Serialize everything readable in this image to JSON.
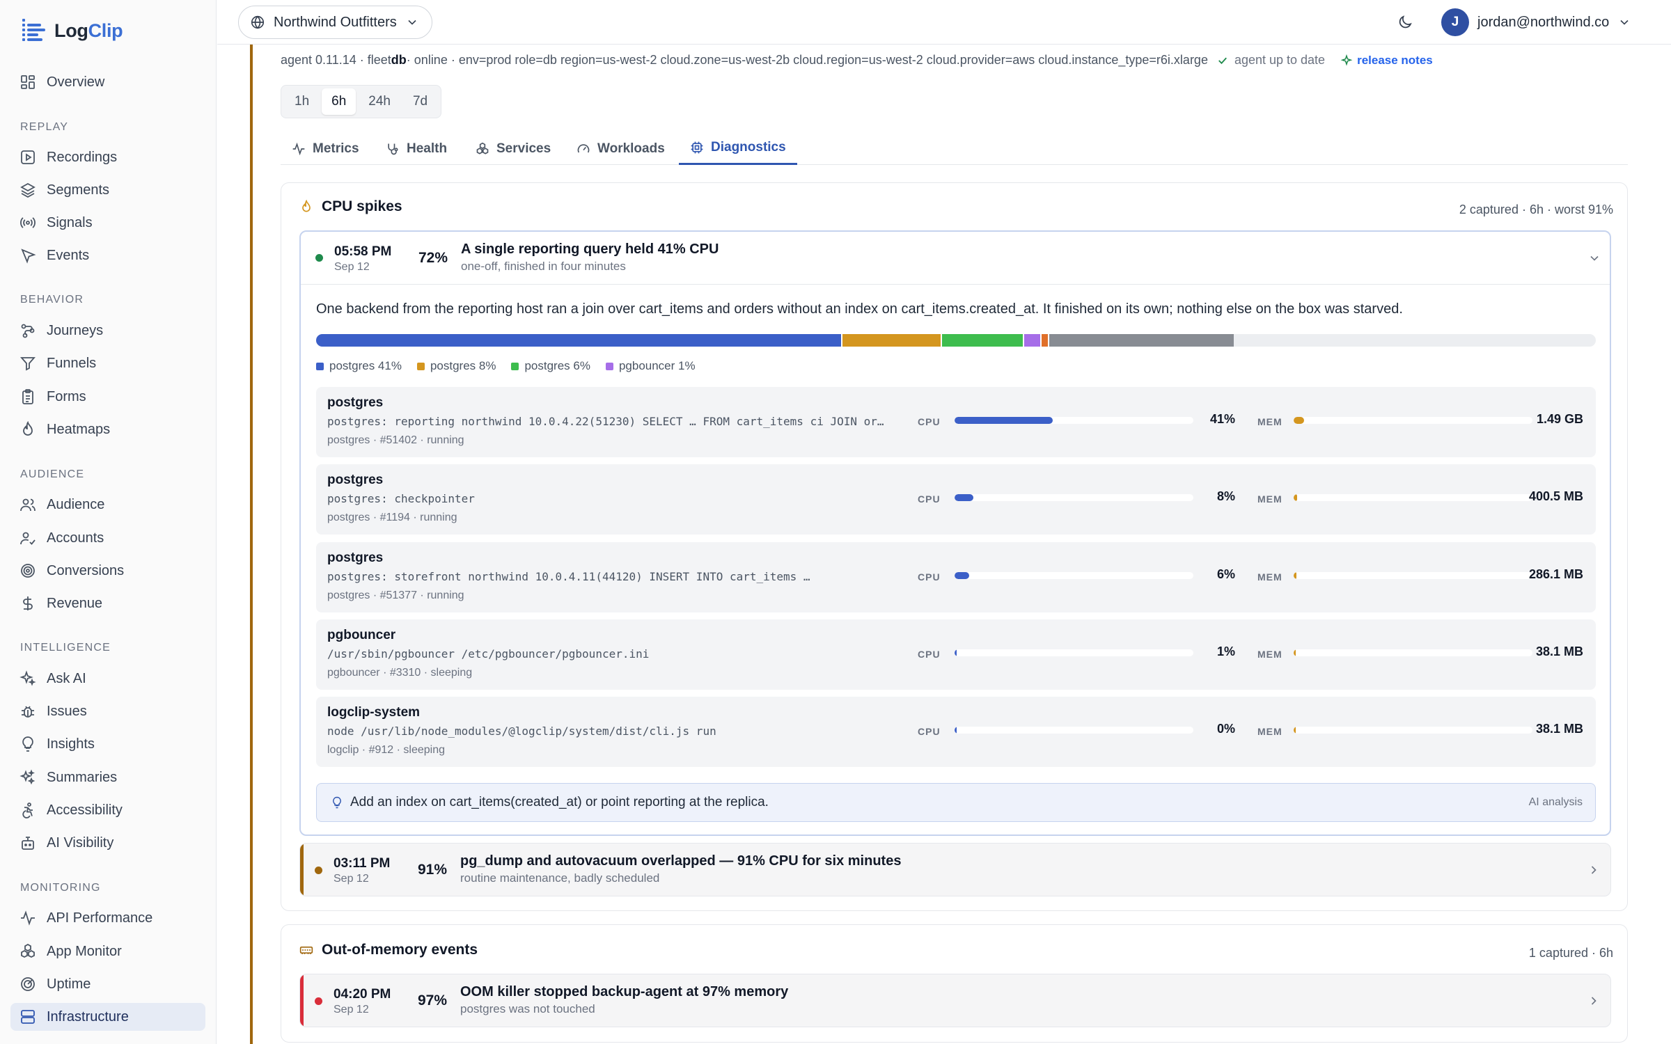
{
  "app": {
    "logo_main": "Log",
    "logo_accent": "Clip"
  },
  "sidebar": {
    "overview": "Overview",
    "sections": {
      "replay": "REPLAY",
      "behavior": "BEHAVIOR",
      "audience": "AUDIENCE",
      "intelligence": "INTELLIGENCE",
      "monitoring": "MONITORING"
    },
    "replay": [
      "Recordings",
      "Segments",
      "Signals",
      "Events"
    ],
    "behavior": [
      "Journeys",
      "Funnels",
      "Forms",
      "Heatmaps"
    ],
    "audience": [
      "Audience",
      "Accounts",
      "Conversions",
      "Revenue"
    ],
    "intelligence": [
      "Ask AI",
      "Issues",
      "Insights",
      "Summaries",
      "Accessibility",
      "AI Visibility"
    ],
    "monitoring": [
      "API Performance",
      "App Monitor",
      "Uptime",
      "Infrastructure"
    ],
    "active": "Infrastructure"
  },
  "topbar": {
    "org": "Northwind Outfitters",
    "user_initial": "J",
    "user_email": "jordan@northwind.co"
  },
  "host": {
    "meta_prefix": "agent 0.11.14 · fleet ",
    "fleet": "db",
    "meta_suffix": " · online · env=prod role=db region=us-west-2 cloud.zone=us-west-2b cloud.region=us-west-2 cloud.provider=aws cloud.instance_type=r6i.xlarge",
    "agent_status": "agent up to date",
    "release_notes": "release notes"
  },
  "ranges": {
    "options": [
      "1h",
      "6h",
      "24h",
      "7d"
    ],
    "selected": "6h"
  },
  "tabs": {
    "items": [
      "Metrics",
      "Health",
      "Services",
      "Workloads",
      "Diagnostics"
    ],
    "active": "Diagnostics"
  },
  "cpu_spikes": {
    "title": "CPU spikes",
    "summary": "2 captured · 6h · worst 91%",
    "expanded": {
      "time": "05:58 PM",
      "date": "Sep 12",
      "pct": "72%",
      "title": "A single reporting query held 41% CPU",
      "subtitle": "one-off, finished in four minutes",
      "description": "One backend from the reporting host ran a join over cart_items and orders without an index on cart_items.created_at. It finished on its own; nothing else on the box was starved.",
      "breakdown": [
        {
          "label": "postgres",
          "share": 41,
          "color": "#3b5fc8"
        },
        {
          "label": "postgres",
          "share": 7.8,
          "color": "#d4961f"
        },
        {
          "label": "postgres",
          "share": 6.4,
          "color": "#3ebd4e"
        },
        {
          "label": "pgbouncer",
          "share": 1.4,
          "color": "#a66ee8"
        },
        {
          "label": "",
          "share": 0.6,
          "color": "#e0702a"
        },
        {
          "label": "",
          "share": 14.5,
          "color": "#888c93"
        }
      ],
      "legend": [
        {
          "label": "postgres 41%",
          "color": "#3b5fc8"
        },
        {
          "label": "postgres 8%",
          "color": "#d4961f"
        },
        {
          "label": "postgres 6%",
          "color": "#3ebd4e"
        },
        {
          "label": "pgbouncer 1%",
          "color": "#a66ee8"
        }
      ],
      "processes": [
        {
          "name": "postgres",
          "cmd": "postgres: reporting northwind 10.0.4.22(51230) SELECT … FROM cart_items ci JOIN or…",
          "meta": "postgres · #51402 · running",
          "cpu_label": "CPU",
          "cpu": 41,
          "cpu_text": "41%",
          "mem_label": "MEM",
          "mem": 4.5,
          "mem_text": "1.49 GB"
        },
        {
          "name": "postgres",
          "cmd": "postgres: checkpointer",
          "meta": "postgres · #1194 · running",
          "cpu_label": "CPU",
          "cpu": 8,
          "cpu_text": "8%",
          "mem_label": "MEM",
          "mem": 1.5,
          "mem_text": "400.5 MB"
        },
        {
          "name": "postgres",
          "cmd": "postgres: storefront northwind 10.0.4.11(44120) INSERT INTO cart_items …",
          "meta": "postgres · #51377 · running",
          "cpu_label": "CPU",
          "cpu": 6,
          "cpu_text": "6%",
          "mem_label": "MEM",
          "mem": 1.3,
          "mem_text": "286.1 MB"
        },
        {
          "name": "pgbouncer",
          "cmd": "/usr/sbin/pgbouncer /etc/pgbouncer/pgbouncer.ini",
          "meta": "pgbouncer · #3310 · sleeping",
          "cpu_label": "CPU",
          "cpu": 1,
          "cpu_text": "1%",
          "mem_label": "MEM",
          "mem": 1,
          "mem_text": "38.1 MB"
        },
        {
          "name": "logclip-system",
          "cmd": "node /usr/lib/node_modules/@logclip/system/dist/cli.js run",
          "meta": "logclip · #912 · sleeping",
          "cpu_label": "CPU",
          "cpu": 0.8,
          "cpu_text": "0%",
          "mem_label": "MEM",
          "mem": 1,
          "mem_text": "38.1 MB"
        }
      ],
      "ai_text": "Add an index on cart_items(created_at) or point reporting at the replica.",
      "ai_tag": "AI analysis"
    },
    "collapsed": {
      "time": "03:11 PM",
      "date": "Sep 12",
      "pct": "91%",
      "title": "pg_dump and autovacuum overlapped — 91% CPU for six minutes",
      "subtitle": "routine maintenance, badly scheduled",
      "accent": "#a0670e"
    }
  },
  "oom": {
    "title": "Out-of-memory events",
    "summary": "1 captured · 6h",
    "event": {
      "time": "04:20 PM",
      "date": "Sep 12",
      "pct": "97%",
      "title": "OOM killer stopped backup-agent at 97% memory",
      "subtitle": "postgres was not touched",
      "accent": "#d92d3a"
    }
  },
  "colors": {
    "accent": "#2f56b0",
    "cpu_bar": "#3b5fc8",
    "mem_bar": "#d4961f",
    "status_ok": "#1f8a4c",
    "warning": "#a0670e",
    "danger": "#d92d3a"
  }
}
